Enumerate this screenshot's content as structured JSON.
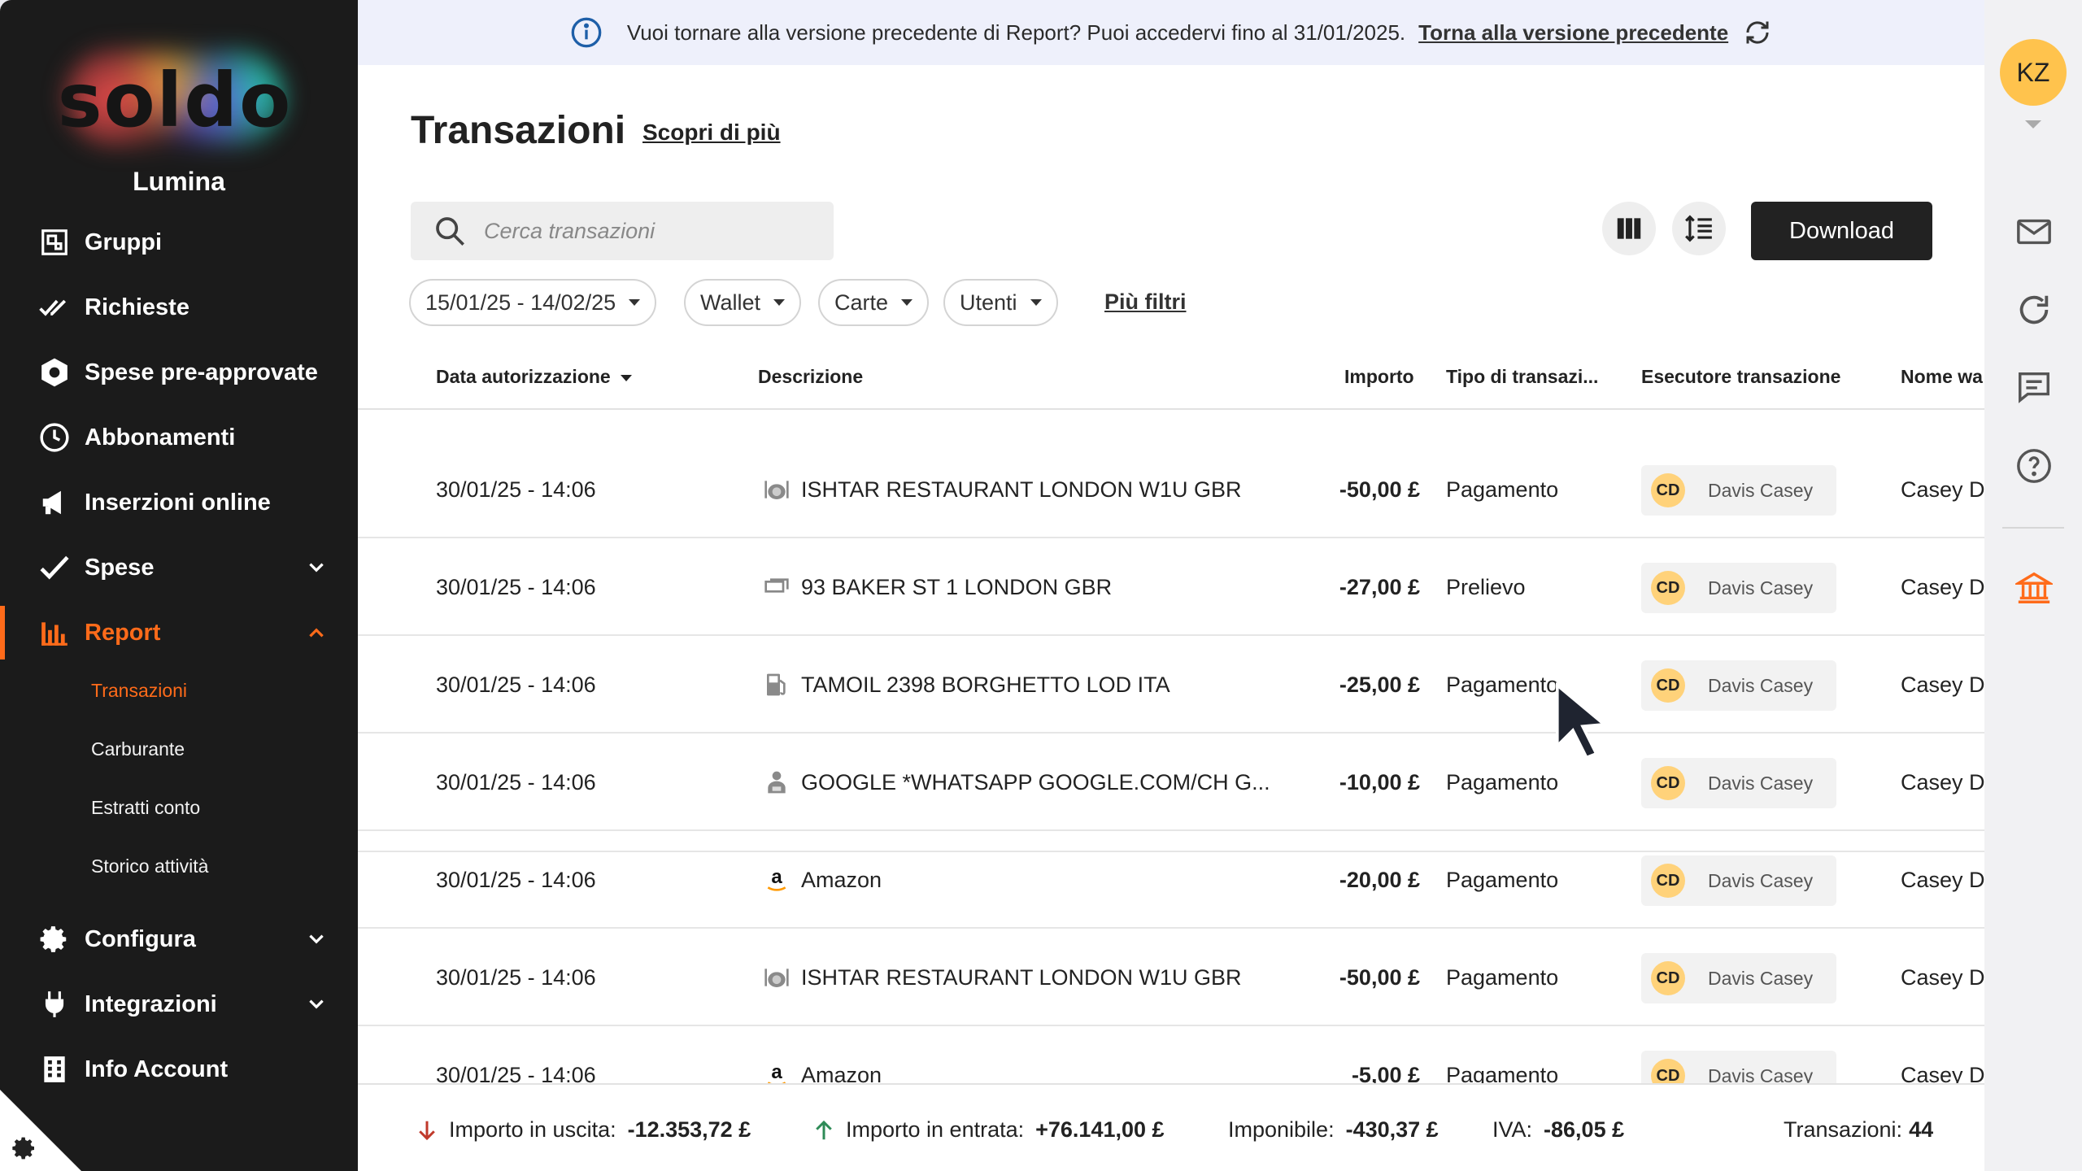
{
  "sidebar": {
    "logo_text": "soldo",
    "company": "Lumina",
    "items": [
      {
        "label": "Gruppi",
        "icon": "groups-icon"
      },
      {
        "label": "Richieste",
        "icon": "double-check-icon"
      },
      {
        "label": "Spese pre-approvate",
        "icon": "hexagon-icon"
      },
      {
        "label": "Abbonamenti",
        "icon": "clock-icon"
      },
      {
        "label": "Inserzioni online",
        "icon": "megaphone-icon"
      },
      {
        "label": "Spese",
        "icon": "check-icon"
      },
      {
        "label": "Report",
        "icon": "bar-chart-icon"
      },
      {
        "label": "Configura",
        "icon": "gear-icon"
      },
      {
        "label": "Integrazioni",
        "icon": "plug-icon"
      },
      {
        "label": "Info Account",
        "icon": "building-icon"
      }
    ],
    "report_sub": [
      "Transazioni",
      "Carburante",
      "Estratti conto",
      "Storico attività"
    ]
  },
  "banner": {
    "text": "Vuoi tornare alla versione precedente di Report? Puoi accedervi fino al 31/01/2025.",
    "link": "Torna alla versione precedente"
  },
  "page": {
    "title": "Transazioni",
    "learn_more": "Scopri di più",
    "search_placeholder": "Cerca transazioni",
    "download": "Download",
    "filters": [
      "15/01/25 - 14/02/25",
      "Wallet",
      "Carte",
      "Utenti"
    ],
    "more_filters": "Più filtri"
  },
  "table": {
    "headers": {
      "date": "Data autorizzazione",
      "description": "Descrizione",
      "amount": "Importo",
      "type": "Tipo di transazi...",
      "executor": "Esecutore transazione",
      "wallet": "Nome wa"
    },
    "rows": [
      {
        "date": "30/01/25 - 14:06",
        "icon": "restaurant-icon",
        "desc": "ISHTAR RESTAURANT LONDON W1U GBR",
        "amount": "-50,00 £",
        "type": "Pagamento",
        "initials": "CD",
        "executor": "Davis Casey",
        "wallet": "Casey Da"
      },
      {
        "date": "30/01/25 - 14:06",
        "icon": "cash-icon",
        "desc": "93 BAKER ST 1 LONDON GBR",
        "amount": "-27,00 £",
        "type": "Prelievo",
        "initials": "CD",
        "executor": "Davis Casey",
        "wallet": "Casey Da"
      },
      {
        "date": "30/01/25 - 14:06",
        "icon": "fuel-icon",
        "desc": "TAMOIL 2398 BORGHETTO LOD ITA",
        "amount": "-25,00 £",
        "type": "Pagamento",
        "initials": "CD",
        "executor": "Davis Casey",
        "wallet": "Casey Da"
      },
      {
        "date": "30/01/25 - 14:06",
        "icon": "person-icon",
        "desc": "GOOGLE *WHATSAPP GOOGLE.COM/CH G...",
        "amount": "-10,00 £",
        "type": "Pagamento",
        "initials": "CD",
        "executor": "Davis Casey",
        "wallet": "Casey Da"
      },
      {
        "date": "30/01/25 - 14:06",
        "icon": "amazon-icon",
        "desc": "Amazon",
        "amount": "-20,00 £",
        "type": "Pagamento",
        "initials": "CD",
        "executor": "Davis Casey",
        "wallet": "Casey Da"
      },
      {
        "date": "30/01/25 - 14:06",
        "icon": "restaurant-icon",
        "desc": "ISHTAR RESTAURANT LONDON W1U GBR",
        "amount": "-50,00 £",
        "type": "Pagamento",
        "initials": "CD",
        "executor": "Davis Casey",
        "wallet": "Casey Da"
      },
      {
        "date": "30/01/25 - 14:06",
        "icon": "amazon-icon",
        "desc": "Amazon",
        "amount": "-5,00 £",
        "type": "Pagamento",
        "initials": "CD",
        "executor": "Davis Casey",
        "wallet": "Casey Da"
      }
    ]
  },
  "footer": {
    "out_label": "Importo in uscita:",
    "out_value": "-12.353,72 £",
    "in_label": "Importo in entrata:",
    "in_value": "+76.141,00 £",
    "taxable_label": "Imponibile:",
    "taxable_value": "-430,37 £",
    "vat_label": "IVA:",
    "vat_value": "-86,05 £",
    "count_label": "Transazioni:",
    "count_value": "44"
  },
  "rail": {
    "avatar": "KZ",
    "icons": [
      "mail-icon",
      "refresh-icon",
      "chat-icon",
      "help-icon",
      "bank-icon"
    ]
  },
  "colors": {
    "accent": "#ff6b1a",
    "sidebar": "#1b1b1b",
    "avatar": "#ffd27a"
  }
}
